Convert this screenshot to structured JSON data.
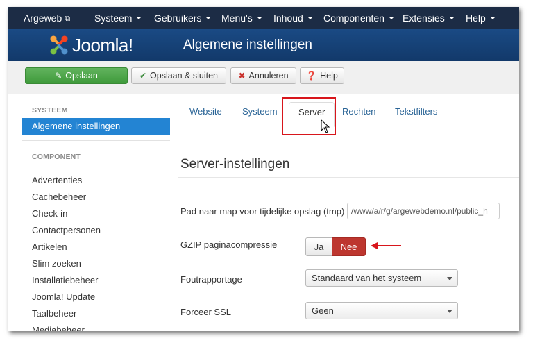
{
  "navbar": {
    "site_label": "Argeweb",
    "menus": [
      "Systeem",
      "Gebruikers",
      "Menu's",
      "Inhoud",
      "Componenten",
      "Extensies",
      "Help"
    ]
  },
  "header": {
    "logo_text": "Joomla!",
    "page_title": "Algemene instellingen"
  },
  "toolbar": {
    "save": "Opslaan",
    "save_close": "Opslaan & sluiten",
    "cancel": "Annuleren",
    "help": "Help"
  },
  "sidebar": {
    "system_heading": "SYSTEEM",
    "active_item": "Algemene instellingen",
    "component_heading": "COMPONENT",
    "items": [
      "Advertenties",
      "Cachebeheer",
      "Check-in",
      "Contactpersonen",
      "Artikelen",
      "Slim zoeken",
      "Installatiebeheer",
      "Joomla! Update",
      "Taalbeheer",
      "Mediabeheer"
    ]
  },
  "tabs": [
    "Website",
    "Systeem",
    "Server",
    "Rechten",
    "Tekstfilters"
  ],
  "active_tab": "Server",
  "section": {
    "title": "Server-instellingen"
  },
  "fields": {
    "tmp_label": "Pad naar map voor tijdelijke opslag (tmp)",
    "tmp_value": "/www/a/r/g/argewebdemo.nl/public_h",
    "gzip_label": "GZIP paginacompressie",
    "gzip_yes": "Ja",
    "gzip_no": "Nee",
    "error_label": "Foutrapportage",
    "error_value": "Standaard van het systeem",
    "ssl_label": "Forceer SSL",
    "ssl_value": "Geen"
  },
  "colors": {
    "navbar": "#1c2c45",
    "header": "#1a4a84",
    "active": "#2384d3",
    "save_green": "#46a546",
    "toggle_red": "#bd362f",
    "highlight": "#d8161c"
  }
}
